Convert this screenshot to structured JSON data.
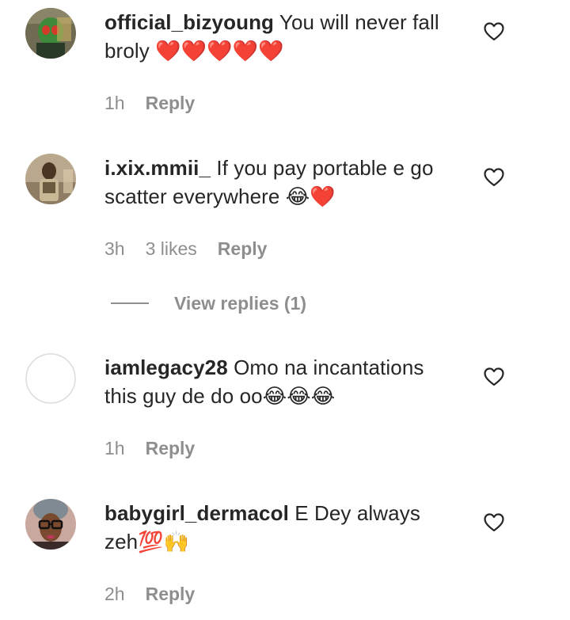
{
  "comments": [
    {
      "username": "official_bizyoung",
      "text": "You will never fall broly ❤️❤️❤️❤️❤️",
      "time": "1h",
      "likes": "",
      "reply_label": "Reply",
      "avatar_icon": "avatar-masked-figure"
    },
    {
      "username": "i.xix.mmii_",
      "text": "If you pay portable e go scatter everywhere 😂❤️",
      "time": "3h",
      "likes": "3 likes",
      "reply_label": "Reply",
      "avatar_icon": "avatar-child-photo"
    },
    {
      "username": "iamlegacy28",
      "text": "Omo na incantations this guy de do oo😂😂😂",
      "time": "1h",
      "likes": "",
      "reply_label": "Reply",
      "avatar_icon": "avatar-placeholder"
    },
    {
      "username": "babygirl_dermacol",
      "text": "E Dey always zeh💯🙌",
      "time": "2h",
      "likes": "",
      "reply_label": "Reply",
      "avatar_icon": "avatar-woman-glasses"
    }
  ],
  "view_replies_label": "View replies (1)",
  "colors": {
    "text": "#262626",
    "secondary": "#8e8e8e",
    "background": "#ffffff"
  },
  "icons": {
    "like": "heart-outline-icon"
  }
}
